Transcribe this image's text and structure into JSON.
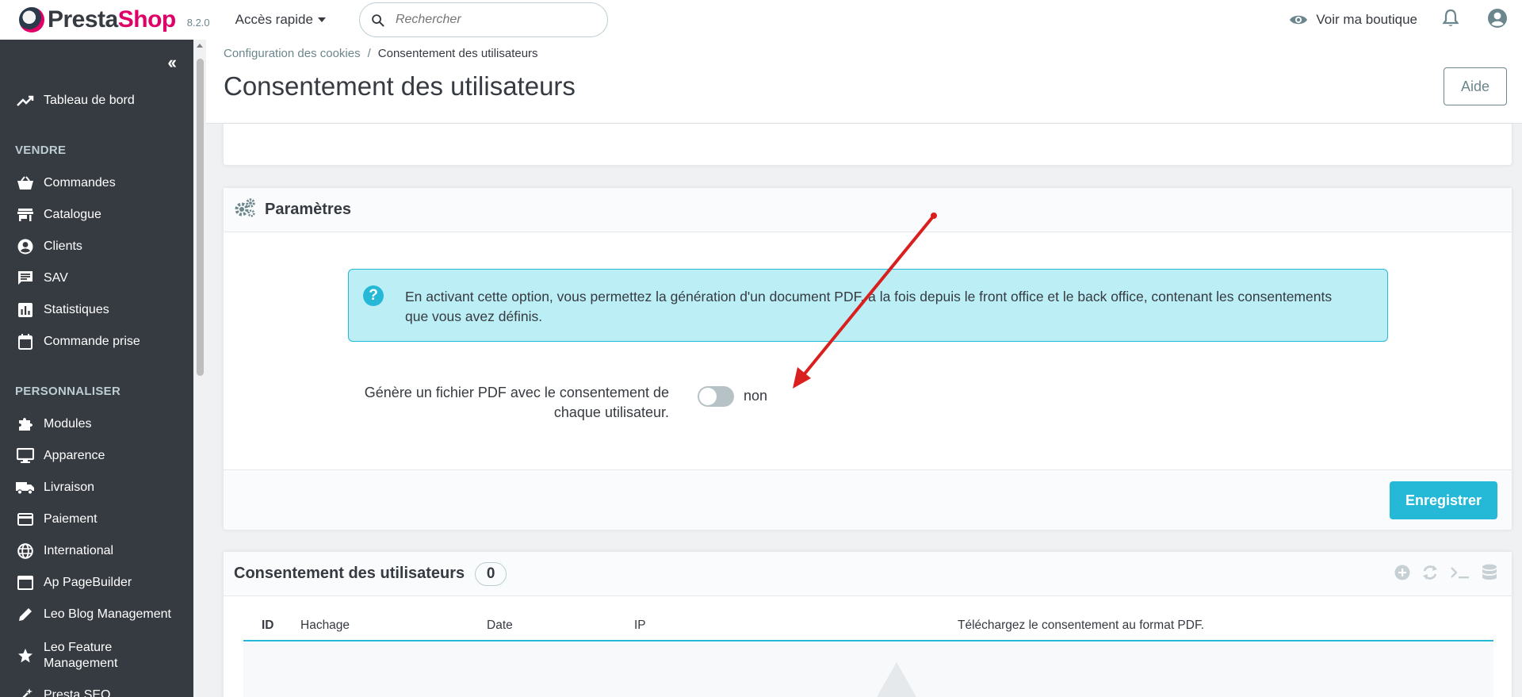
{
  "header": {
    "logo_presta": "Presta",
    "logo_shop": "Shop",
    "version": "8.2.0",
    "quick_access": "Accès rapide",
    "search_placeholder": "Rechercher",
    "view_shop": "Voir ma boutique"
  },
  "sidebar": {
    "dashboard": "Tableau de bord",
    "sections": [
      {
        "title": "VENDRE",
        "items": [
          "Commandes",
          "Catalogue",
          "Clients",
          "SAV",
          "Statistiques",
          "Commande prise"
        ]
      },
      {
        "title": "PERSONNALISER",
        "items": [
          "Modules",
          "Apparence",
          "Livraison",
          "Paiement",
          "International",
          "Ap PageBuilder",
          "Leo Blog Management",
          "Leo Feature Management",
          "Presta SEO"
        ]
      }
    ]
  },
  "breadcrumb": {
    "parent": "Configuration des cookies",
    "separator": "/",
    "current": "Consentement des utilisateurs"
  },
  "page": {
    "title": "Consentement des utilisateurs",
    "help_button": "Aide"
  },
  "params": {
    "title": "Paramètres",
    "info_text": "En activant cette option, vous permettez la génération d'un document PDF, à la fois depuis le front office et le back office, contenant les consentements que vous avez définis.",
    "field_label": "Génère un fichier PDF avec le consentement de chaque utilisateur.",
    "switch_state": "non",
    "switch_on": false,
    "save_button": "Enregistrer"
  },
  "list": {
    "title": "Consentement des utilisateurs",
    "count": "0",
    "columns": [
      "ID",
      "Hachage",
      "Date",
      "IP",
      "Téléchargez le consentement au format PDF."
    ]
  },
  "colors": {
    "accent": "#25b9d7",
    "brand": "#df0067",
    "sidebar": "#363a41",
    "annotation_arrow": "#d9201f"
  }
}
